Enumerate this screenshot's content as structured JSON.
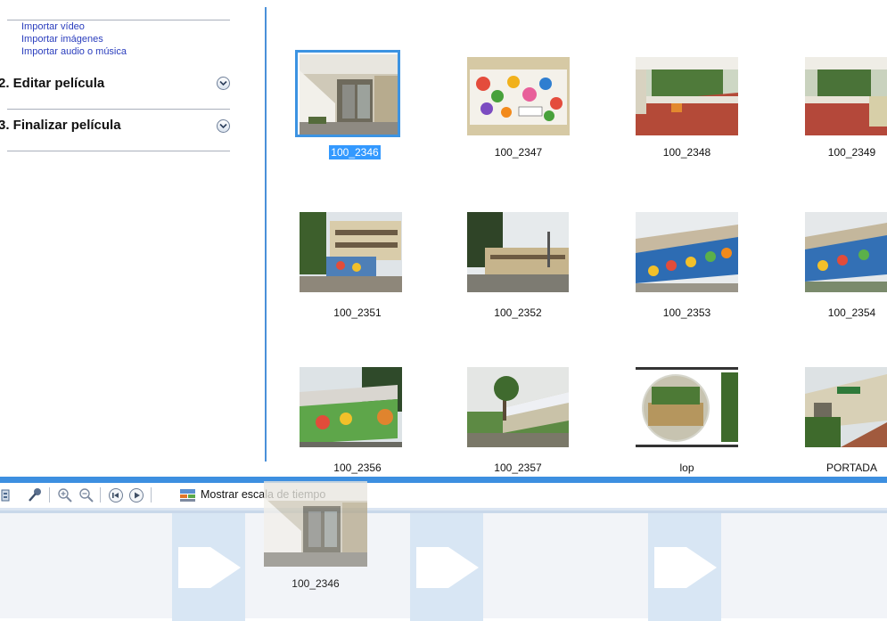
{
  "task_pane": {
    "import_links": [
      "Importar vídeo",
      "Importar imágenes",
      "Importar audio o música"
    ],
    "sections": [
      {
        "label": "2. Editar película"
      },
      {
        "label": "3. Finalizar película"
      }
    ],
    "section_prefix_visible": [
      "2. ",
      "3. "
    ]
  },
  "collection": {
    "items": [
      {
        "label": "100_2346",
        "selected": true
      },
      {
        "label": "100_2347"
      },
      {
        "label": "100_2348"
      },
      {
        "label": "100_2349"
      },
      {
        "label": "100_2351"
      },
      {
        "label": "100_2352"
      },
      {
        "label": "100_2353"
      },
      {
        "label": "100_2354"
      },
      {
        "label": "100_2356"
      },
      {
        "label": "100_2357"
      },
      {
        "label": "lop"
      },
      {
        "label": "PORTADA"
      }
    ]
  },
  "toolbar": {
    "timeline_toggle_label": "Mostrar escala de tiempo",
    "icons": [
      "storyboard-icon",
      "narrate-icon",
      "zoom-in-icon",
      "zoom-out-icon",
      "rewind-icon",
      "play-icon",
      "timeline-icon"
    ]
  },
  "drag_preview": {
    "label": "100_2346"
  },
  "colors": {
    "accent": "#3d8fe0",
    "selection": "#3399ff",
    "link": "#2a3dbd"
  }
}
